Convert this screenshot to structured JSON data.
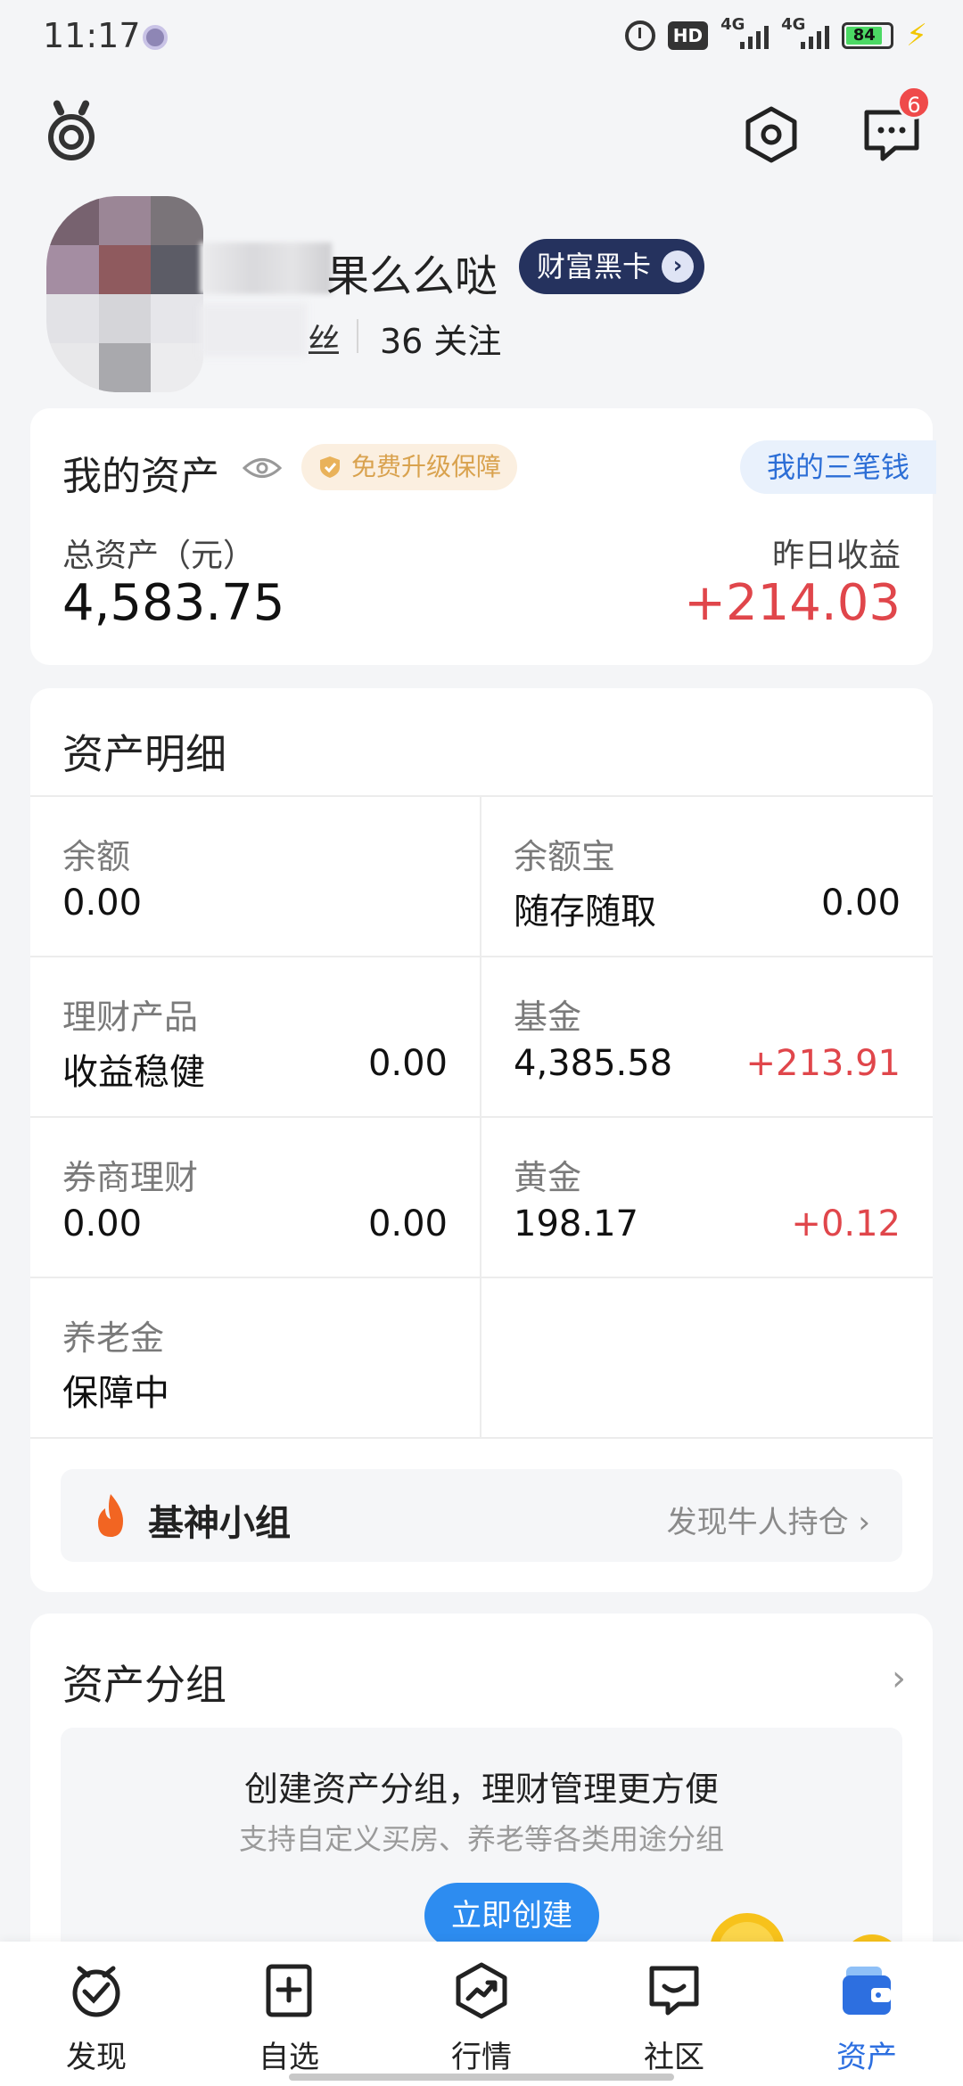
{
  "status_bar": {
    "time": "11:17",
    "hd_label": "HD",
    "network_label_1": "4G",
    "network_label_2": "4G",
    "battery": "84"
  },
  "header": {
    "message_badge": "6"
  },
  "profile": {
    "nickname": "果么么哒",
    "vip_label": "财富黑卡",
    "vip_arrow": "›",
    "fans_fragment": "丝",
    "following": "36 关注"
  },
  "assets": {
    "title": "我的资产",
    "upgrade_label": "免费升级保障",
    "three_money_label": "我的三笔钱",
    "total_label": "总资产（元）",
    "total_value": "4,583.75",
    "yesterday_label": "昨日收益",
    "yesterday_value": "+214.03"
  },
  "detail": {
    "title": "资产明细",
    "cells": [
      {
        "title": "余额",
        "sub": "0.00",
        "value": ""
      },
      {
        "title": "余额宝",
        "sub": "随存随取",
        "value": "0.00"
      },
      {
        "title": "理财产品",
        "sub": "收益稳健",
        "value": "0.00"
      },
      {
        "title": "基金",
        "sub": "4,385.58",
        "value": "+213.91"
      },
      {
        "title": "券商理财",
        "sub": "0.00",
        "value": "0.00"
      },
      {
        "title": "黄金",
        "sub": "198.17",
        "value": "+0.12"
      },
      {
        "title": "养老金",
        "sub": "保障中",
        "value": ""
      }
    ],
    "group_name": "基神小组",
    "group_link": "发现牛人持仓 ›"
  },
  "asset_group": {
    "title": "资产分组",
    "chevron": "›",
    "headline": "创建资产分组，理财管理更方便",
    "subline": "支持自定义买房、养老等各类用途分组",
    "button": "立即创建"
  },
  "nav": [
    {
      "label": "发现",
      "icon": "discover-icon"
    },
    {
      "label": "自选",
      "icon": "watchlist-icon"
    },
    {
      "label": "行情",
      "icon": "market-icon"
    },
    {
      "label": "社区",
      "icon": "community-icon"
    },
    {
      "label": "资产",
      "icon": "assets-icon",
      "active": true
    }
  ],
  "colors": {
    "accent": "#2d6fe0",
    "gain": "#e0464b",
    "vip_bg": "#25325e",
    "button_blue": "#2d8cf0"
  }
}
